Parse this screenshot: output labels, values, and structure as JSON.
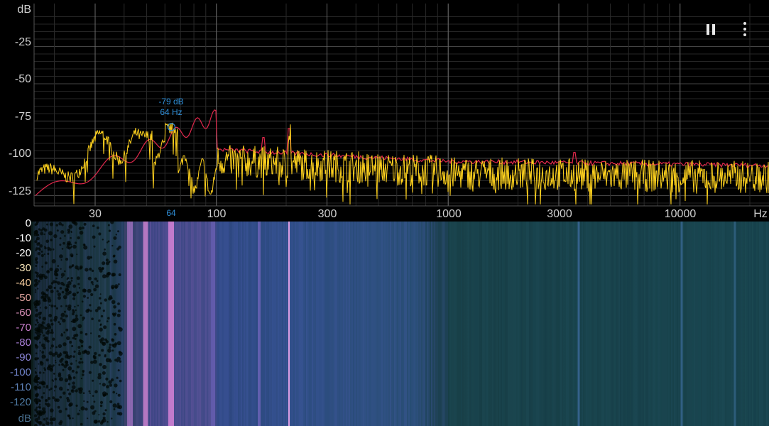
{
  "app": {
    "pause_icon": "pause-icon",
    "menu_icon": "vertical-dots-menu-icon"
  },
  "spectrum": {
    "y_unit": "dB",
    "y_ticks": [
      "-25",
      "-50",
      "-75",
      "-100",
      "-125"
    ],
    "x_ticks": [
      "30",
      "100",
      "300",
      "1000",
      "3000",
      "10000"
    ],
    "x_unit": "Hz",
    "peak": {
      "level": "-79 dB",
      "freq": "64 Hz",
      "freq_axis": "64"
    },
    "colors": {
      "peak_hold": "#e0284c",
      "live": "#ffd21e",
      "peak_marker": "#2f8fd8",
      "grid": "#3a3a3a"
    }
  },
  "spectrogram": {
    "scale_top": "0",
    "scale_ticks": [
      "-10",
      "-20",
      "-30",
      "-40",
      "-50",
      "-60",
      "-70",
      "-80",
      "-90",
      "-100",
      "-110",
      "-120"
    ],
    "scale_unit": "dB",
    "scale_colors": [
      "#ffffff",
      "#ffffff",
      "#ffffff",
      "#f6e3b8",
      "#f1c89b",
      "#e6a7a2",
      "#d88fb8",
      "#c67dca",
      "#a97fd7",
      "#8a84d6",
      "#6f82c8",
      "#5c7fb4",
      "#4e7aa3",
      "#4a7191"
    ]
  }
}
